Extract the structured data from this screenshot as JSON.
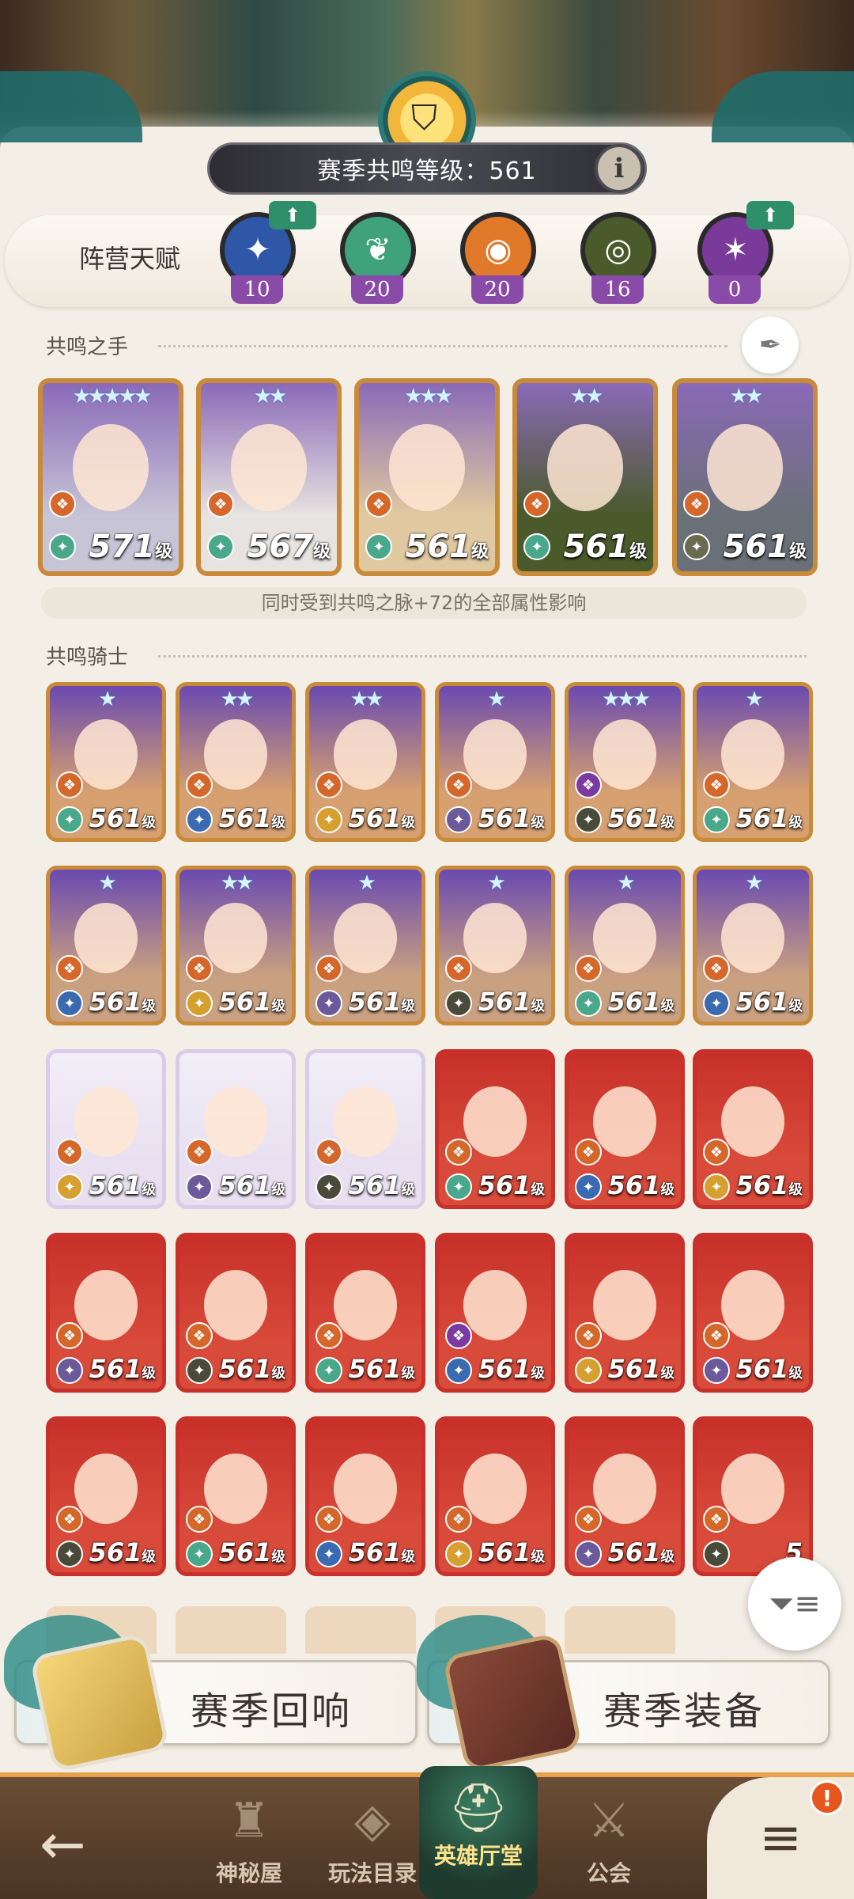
{
  "header": {
    "level_label": "赛季共鸣等级：561",
    "info_label": "i",
    "crest_icon": "spartan-helmet-icon"
  },
  "faction_talent": {
    "label": "阵营天赋",
    "items": [
      {
        "icon": "lightbearer-icon",
        "value": "10",
        "color": "#2f57a8",
        "upgrade": true
      },
      {
        "icon": "wilder-icon",
        "value": "20",
        "color": "#3fa27a",
        "upgrade": false
      },
      {
        "icon": "graveborn-icon",
        "value": "20",
        "color": "#e07a2a",
        "upgrade": false
      },
      {
        "icon": "mauler-icon",
        "value": "16",
        "color": "#4a5a2a",
        "upgrade": false
      },
      {
        "icon": "celestial-hypogean-icon",
        "value": "0",
        "color": "#7a3a9a",
        "upgrade": true
      }
    ],
    "upgrade_symbol": "⬆"
  },
  "resonance_hand": {
    "title": "共鸣之手",
    "note": "同时受到共鸣之脉+72的全部属性影响",
    "heroes": [
      {
        "level": "571",
        "unit": "级",
        "stars": "★★★★★"
      },
      {
        "level": "567",
        "unit": "级",
        "stars": "★★"
      },
      {
        "level": "561",
        "unit": "级",
        "stars": "★★★"
      },
      {
        "level": "561",
        "unit": "级",
        "stars": "★★"
      },
      {
        "level": "561",
        "unit": "级",
        "stars": "★★"
      }
    ]
  },
  "resonance_knights": {
    "title": "共鸣骑士",
    "rows": [
      [
        {
          "level": "561",
          "unit": "级",
          "stars": "★"
        },
        {
          "level": "561",
          "unit": "级",
          "stars": "★★"
        },
        {
          "level": "561",
          "unit": "级",
          "stars": "★★"
        },
        {
          "level": "561",
          "unit": "级",
          "stars": "★"
        },
        {
          "level": "561",
          "unit": "级",
          "stars": "★★★"
        },
        {
          "level": "561",
          "unit": "级",
          "stars": "★"
        }
      ],
      [
        {
          "level": "561",
          "unit": "级",
          "stars": "★"
        },
        {
          "level": "561",
          "unit": "级",
          "stars": "★★"
        },
        {
          "level": "561",
          "unit": "级",
          "stars": "★"
        },
        {
          "level": "561",
          "unit": "级",
          "stars": "★"
        },
        {
          "level": "561",
          "unit": "级",
          "stars": "★"
        },
        {
          "level": "561",
          "unit": "级",
          "stars": "★"
        }
      ],
      [
        {
          "level": "561",
          "unit": "级",
          "stars": ""
        },
        {
          "level": "561",
          "unit": "级",
          "stars": ""
        },
        {
          "level": "561",
          "unit": "级",
          "stars": ""
        },
        {
          "level": "561",
          "unit": "级",
          "stars": ""
        },
        {
          "level": "561",
          "unit": "级",
          "stars": ""
        },
        {
          "level": "561",
          "unit": "级",
          "stars": ""
        }
      ],
      [
        {
          "level": "561",
          "unit": "级",
          "stars": ""
        },
        {
          "level": "561",
          "unit": "级",
          "stars": ""
        },
        {
          "level": "561",
          "unit": "级",
          "stars": ""
        },
        {
          "level": "561",
          "unit": "级",
          "stars": ""
        },
        {
          "level": "561",
          "unit": "级",
          "stars": ""
        },
        {
          "level": "561",
          "unit": "级",
          "stars": ""
        }
      ],
      [
        {
          "level": "561",
          "unit": "级",
          "stars": ""
        },
        {
          "level": "561",
          "unit": "级",
          "stars": ""
        },
        {
          "level": "561",
          "unit": "级",
          "stars": ""
        },
        {
          "level": "561",
          "unit": "级",
          "stars": ""
        },
        {
          "level": "561",
          "unit": "级",
          "stars": ""
        },
        {
          "level": "5",
          "unit": "",
          "stars": ""
        }
      ]
    ]
  },
  "banners": {
    "echo_label": "赛季回响",
    "gear_label": "赛季装备"
  },
  "nav": {
    "back_icon": "←",
    "items": [
      {
        "label": "神秘屋",
        "icon": "tower-icon"
      },
      {
        "label": "玩法目录",
        "icon": "diamond-grid-icon"
      },
      {
        "label": "英雄厅堂",
        "icon": "helmet-icon",
        "active": true
      },
      {
        "label": "公会",
        "icon": "crossed-swords-icon"
      }
    ],
    "menu_badge": "!",
    "menu_icon": "≡"
  },
  "filter_icon": "filter-icon",
  "colors": {
    "accent_gold": "#c98a3a",
    "nav_bg": "#5a3f2a",
    "active_tab": "#2f6b52",
    "badge_red": "#e6571e"
  }
}
